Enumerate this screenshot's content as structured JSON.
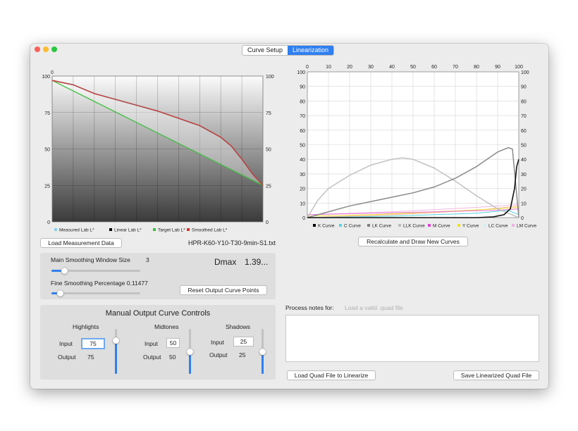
{
  "tabs": [
    {
      "label": "Curve Setup",
      "active": false
    },
    {
      "label": "Linearization",
      "active": true
    }
  ],
  "left_chart": {
    "chart_data": {
      "type": "line",
      "x_range": [
        0,
        100
      ],
      "y_range": [
        0,
        100
      ],
      "y_ticks": [
        "0",
        "25",
        "50",
        "75",
        "100"
      ],
      "x_top_ticks": [
        "0"
      ],
      "legend": [
        {
          "name": "Measured Lab L*",
          "color": "#87ceeb"
        },
        {
          "name": "Linear Lab L*",
          "color": "#000000"
        },
        {
          "name": "Target Lab L*",
          "color": "#3cc03c"
        },
        {
          "name": "Smoothed Lab L*",
          "color": "#e0302a"
        }
      ],
      "series": [
        {
          "name": "Target Lab L*",
          "color": "#3cc03c",
          "x": [
            0,
            100
          ],
          "y": [
            97,
            25
          ]
        },
        {
          "name": "Smoothed Lab L*",
          "color": "#a05050",
          "x": [
            0,
            10,
            20,
            30,
            40,
            50,
            60,
            70,
            80,
            85,
            90,
            95,
            100
          ],
          "y": [
            97,
            94,
            88,
            84,
            80,
            76,
            71,
            66,
            58,
            52,
            43,
            33,
            25
          ]
        }
      ]
    }
  },
  "right_chart": {
    "chart_data": {
      "type": "line",
      "x_range": [
        0,
        100
      ],
      "y_range": [
        0,
        100
      ],
      "x_ticks": [
        "0",
        "10",
        "20",
        "30",
        "40",
        "50",
        "60",
        "70",
        "80",
        "90",
        "100"
      ],
      "y_ticks": [
        "0",
        "10",
        "20",
        "30",
        "40",
        "50",
        "60",
        "70",
        "80",
        "90",
        "100"
      ],
      "legend": [
        {
          "name": "K Curve",
          "color": "#000000"
        },
        {
          "name": "C Curve",
          "color": "#4fd8e0"
        },
        {
          "name": "LK Curve",
          "color": "#808080"
        },
        {
          "name": "LLK Curve",
          "color": "#bdbdbd"
        },
        {
          "name": "M Curve",
          "color": "#e040e0"
        },
        {
          "name": "Y Curve",
          "color": "#f0e020"
        },
        {
          "name": "LC Curve",
          "color": "#cfeff7"
        },
        {
          "name": "LM Curve",
          "color": "#f0b0e0"
        }
      ],
      "series": [
        {
          "name": "K Curve",
          "color": "#111111",
          "x": [
            0,
            20,
            40,
            60,
            80,
            88,
            93,
            96,
            98,
            99,
            100
          ],
          "y": [
            0,
            0,
            0,
            0,
            0,
            0.5,
            2,
            6,
            20,
            35,
            40
          ]
        },
        {
          "name": "LK Curve",
          "color": "#8a8a8a",
          "x": [
            0,
            5,
            10,
            20,
            30,
            40,
            50,
            60,
            70,
            80,
            90,
            95,
            97,
            100
          ],
          "y": [
            0,
            2,
            4,
            8,
            11,
            14,
            17,
            21,
            27,
            35,
            45,
            48,
            47,
            0
          ]
        },
        {
          "name": "LLK Curve",
          "color": "#c2c2c2",
          "x": [
            0,
            5,
            10,
            20,
            30,
            40,
            45,
            50,
            60,
            70,
            80,
            90,
            100
          ],
          "y": [
            0,
            12,
            20,
            29,
            36,
            40,
            41,
            40,
            34,
            25,
            15,
            6,
            0
          ]
        },
        {
          "name": "M Curve",
          "color": "#e879e0",
          "x": [
            0,
            30,
            60,
            90,
            100
          ],
          "y": [
            2,
            3,
            4,
            5,
            6
          ]
        },
        {
          "name": "Y Curve",
          "color": "#f2df40",
          "x": [
            0,
            30,
            60,
            90,
            100
          ],
          "y": [
            1,
            2,
            4,
            6,
            7
          ]
        },
        {
          "name": "C Curve",
          "color": "#58d4dc",
          "x": [
            0,
            40,
            80,
            95,
            100
          ],
          "y": [
            0,
            1,
            3,
            5,
            2
          ]
        },
        {
          "name": "LC Curve",
          "color": "#f3b285",
          "x": [
            0,
            40,
            80,
            100
          ],
          "y": [
            0,
            2,
            5,
            8
          ]
        },
        {
          "name": "LM Curve",
          "color": "#f0b8e2",
          "x": [
            0,
            40,
            80,
            100
          ],
          "y": [
            2,
            4,
            7,
            9
          ]
        }
      ]
    }
  },
  "buttons": {
    "load_measurement": "Load Measurement Data",
    "recalculate": "Recalculate and Draw New Curves",
    "reset_points": "Reset Output Curve Points",
    "load_quad": "Load Quad File to Linearize",
    "save_quad": "Save Linearized Quad File"
  },
  "filename": "HPR-K60-Y10-T30-9min-S1.txt",
  "smoothing": {
    "main_label": "Main Smoothing Window Size",
    "main_value": "3",
    "main_fraction": 0.15,
    "fine_label": "Fine Smoothing Percentage 0.11477",
    "fine_fraction": 0.1
  },
  "dmax": {
    "label": "Dmax",
    "value": "1.39..."
  },
  "manual": {
    "title": "Manual Output Curve Controls",
    "input_label": "Input",
    "output_label": "Output",
    "groups": [
      {
        "name": "Highlights",
        "input": "75",
        "output": "75",
        "fraction": 0.75
      },
      {
        "name": "Midtones",
        "input": "50",
        "output": "50",
        "fraction": 0.5
      },
      {
        "name": "Shadows",
        "input": "25",
        "output": "25",
        "fraction": 0.5
      }
    ]
  },
  "process_notes": {
    "label": "Process notes for:",
    "placeholder": "Load a valid .quad file"
  }
}
